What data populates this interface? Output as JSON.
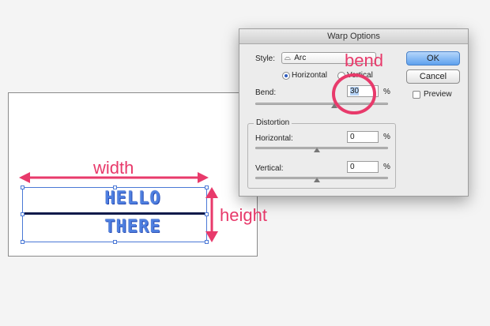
{
  "annotations": {
    "width": "width",
    "height": "height",
    "bend": "bend"
  },
  "artwork": {
    "line1": "HELLO",
    "line2": "THERE"
  },
  "dialog": {
    "title": "Warp Options",
    "style": {
      "label": "Style:",
      "value": "Arc"
    },
    "orientation": {
      "horizontal": "Horizontal",
      "vertical": "Vertical",
      "selected": "Horizontal"
    },
    "bend": {
      "label": "Bend:",
      "value": "30",
      "unit": "%"
    },
    "distortion": {
      "title": "Distortion",
      "horizontal": {
        "label": "Horizontal:",
        "value": "0",
        "unit": "%"
      },
      "vertical": {
        "label": "Vertical:",
        "value": "0",
        "unit": "%"
      }
    },
    "buttons": {
      "ok": "OK",
      "cancel": "Cancel"
    },
    "preview": {
      "label": "Preview",
      "checked": false
    }
  },
  "colors": {
    "annotation": "#e83a6b",
    "art_text": "#4e7fe0",
    "selection": "#4a78d6",
    "primary_button": "#5ea1ee"
  },
  "icons": {
    "style_icon": "arc-style-icon",
    "dropdown": "chevron-down-icon"
  }
}
